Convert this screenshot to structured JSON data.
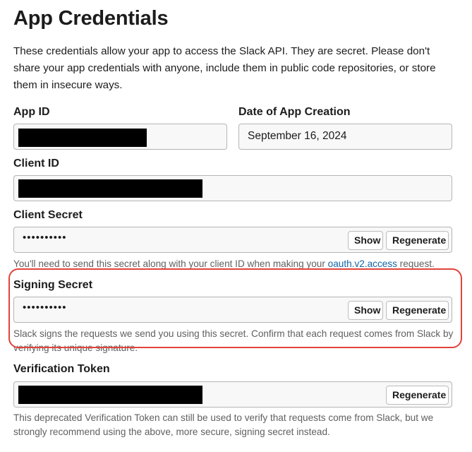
{
  "page": {
    "title": "App Credentials",
    "intro": "These credentials allow your app to access the Slack API. They are secret. Please don't share your app credentials with anyone, include them in public code repositories, or store them in insecure ways."
  },
  "app_id": {
    "label": "App ID"
  },
  "date_created": {
    "label": "Date of App Creation",
    "value": "September 16, 2024"
  },
  "client_id": {
    "label": "Client ID"
  },
  "client_secret": {
    "label": "Client Secret",
    "masked_value": "••••••••••",
    "show_label": "Show",
    "regenerate_label": "Regenerate",
    "help_prefix": "You'll need to send this secret along with your client ID when making your ",
    "help_link": "oauth.v2.access",
    "help_suffix": " request."
  },
  "signing_secret": {
    "label": "Signing Secret",
    "masked_value": "••••••••••",
    "show_label": "Show",
    "regenerate_label": "Regenerate",
    "help": "Slack signs the requests we send you using this secret. Confirm that each request comes from Slack by verifying its unique signature."
  },
  "verification_token": {
    "label": "Verification Token",
    "regenerate_label": "Regenerate",
    "help": "This deprecated Verification Token can still be used to verify that requests come from Slack, but we strongly recommend using the above, more secure, signing secret instead."
  },
  "colors": {
    "highlight": "#e0443b",
    "link": "#1264a3",
    "redaction": "#000000"
  }
}
